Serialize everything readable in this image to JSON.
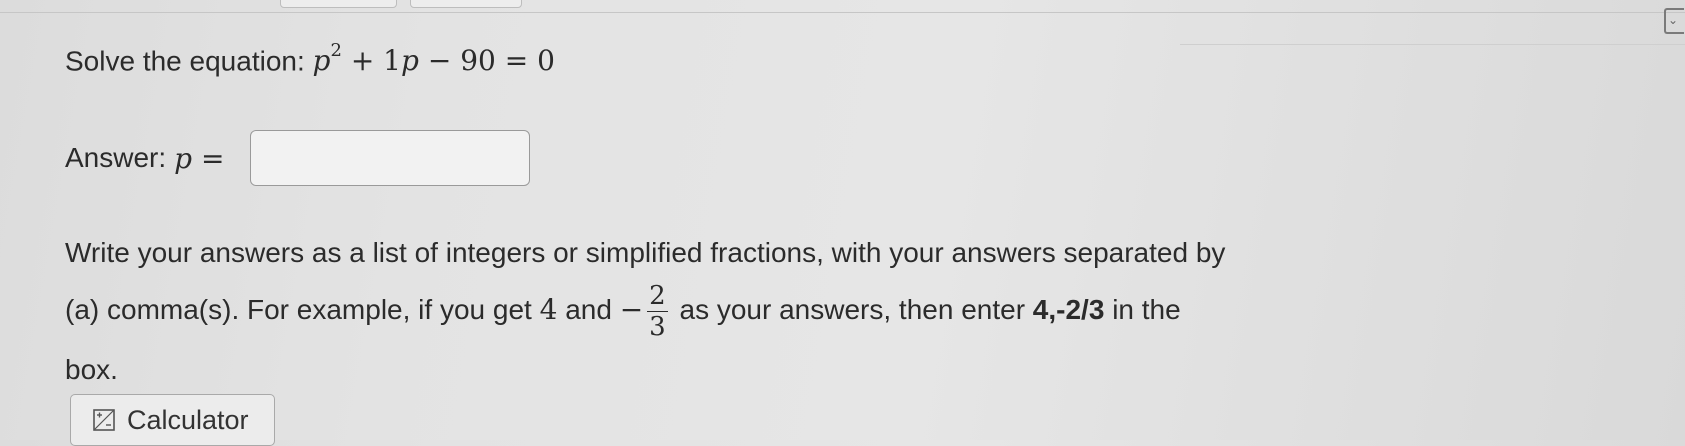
{
  "question": {
    "prefix": "Solve the equation:",
    "equation": {
      "var1": "p",
      "exp": "2",
      "mid": " + 1",
      "var2": "p",
      "rest": " − 90 = 0"
    }
  },
  "answer": {
    "label": "Answer:",
    "var": "p",
    "equals": " =",
    "value": "",
    "placeholder": ""
  },
  "instructions": {
    "line1": "Write your answers as a list of integers or simplified fractions, with your answers separated by",
    "line2_a": "(a) comma(s). For example, if you get",
    "num_example": "4",
    "and": "and",
    "minus": "−",
    "frac_num": "2",
    "frac_den": "3",
    "line2_b": "as your answers, then enter",
    "example_entry": "4,-2/3",
    "line2_c": "in the",
    "line3": "box."
  },
  "calculator": {
    "label": "Calculator",
    "icon": "calculator-icon"
  },
  "colors": {
    "text": "#2b2b2b",
    "input_border": "#9a9a9a",
    "background": "#e3e3e3"
  }
}
